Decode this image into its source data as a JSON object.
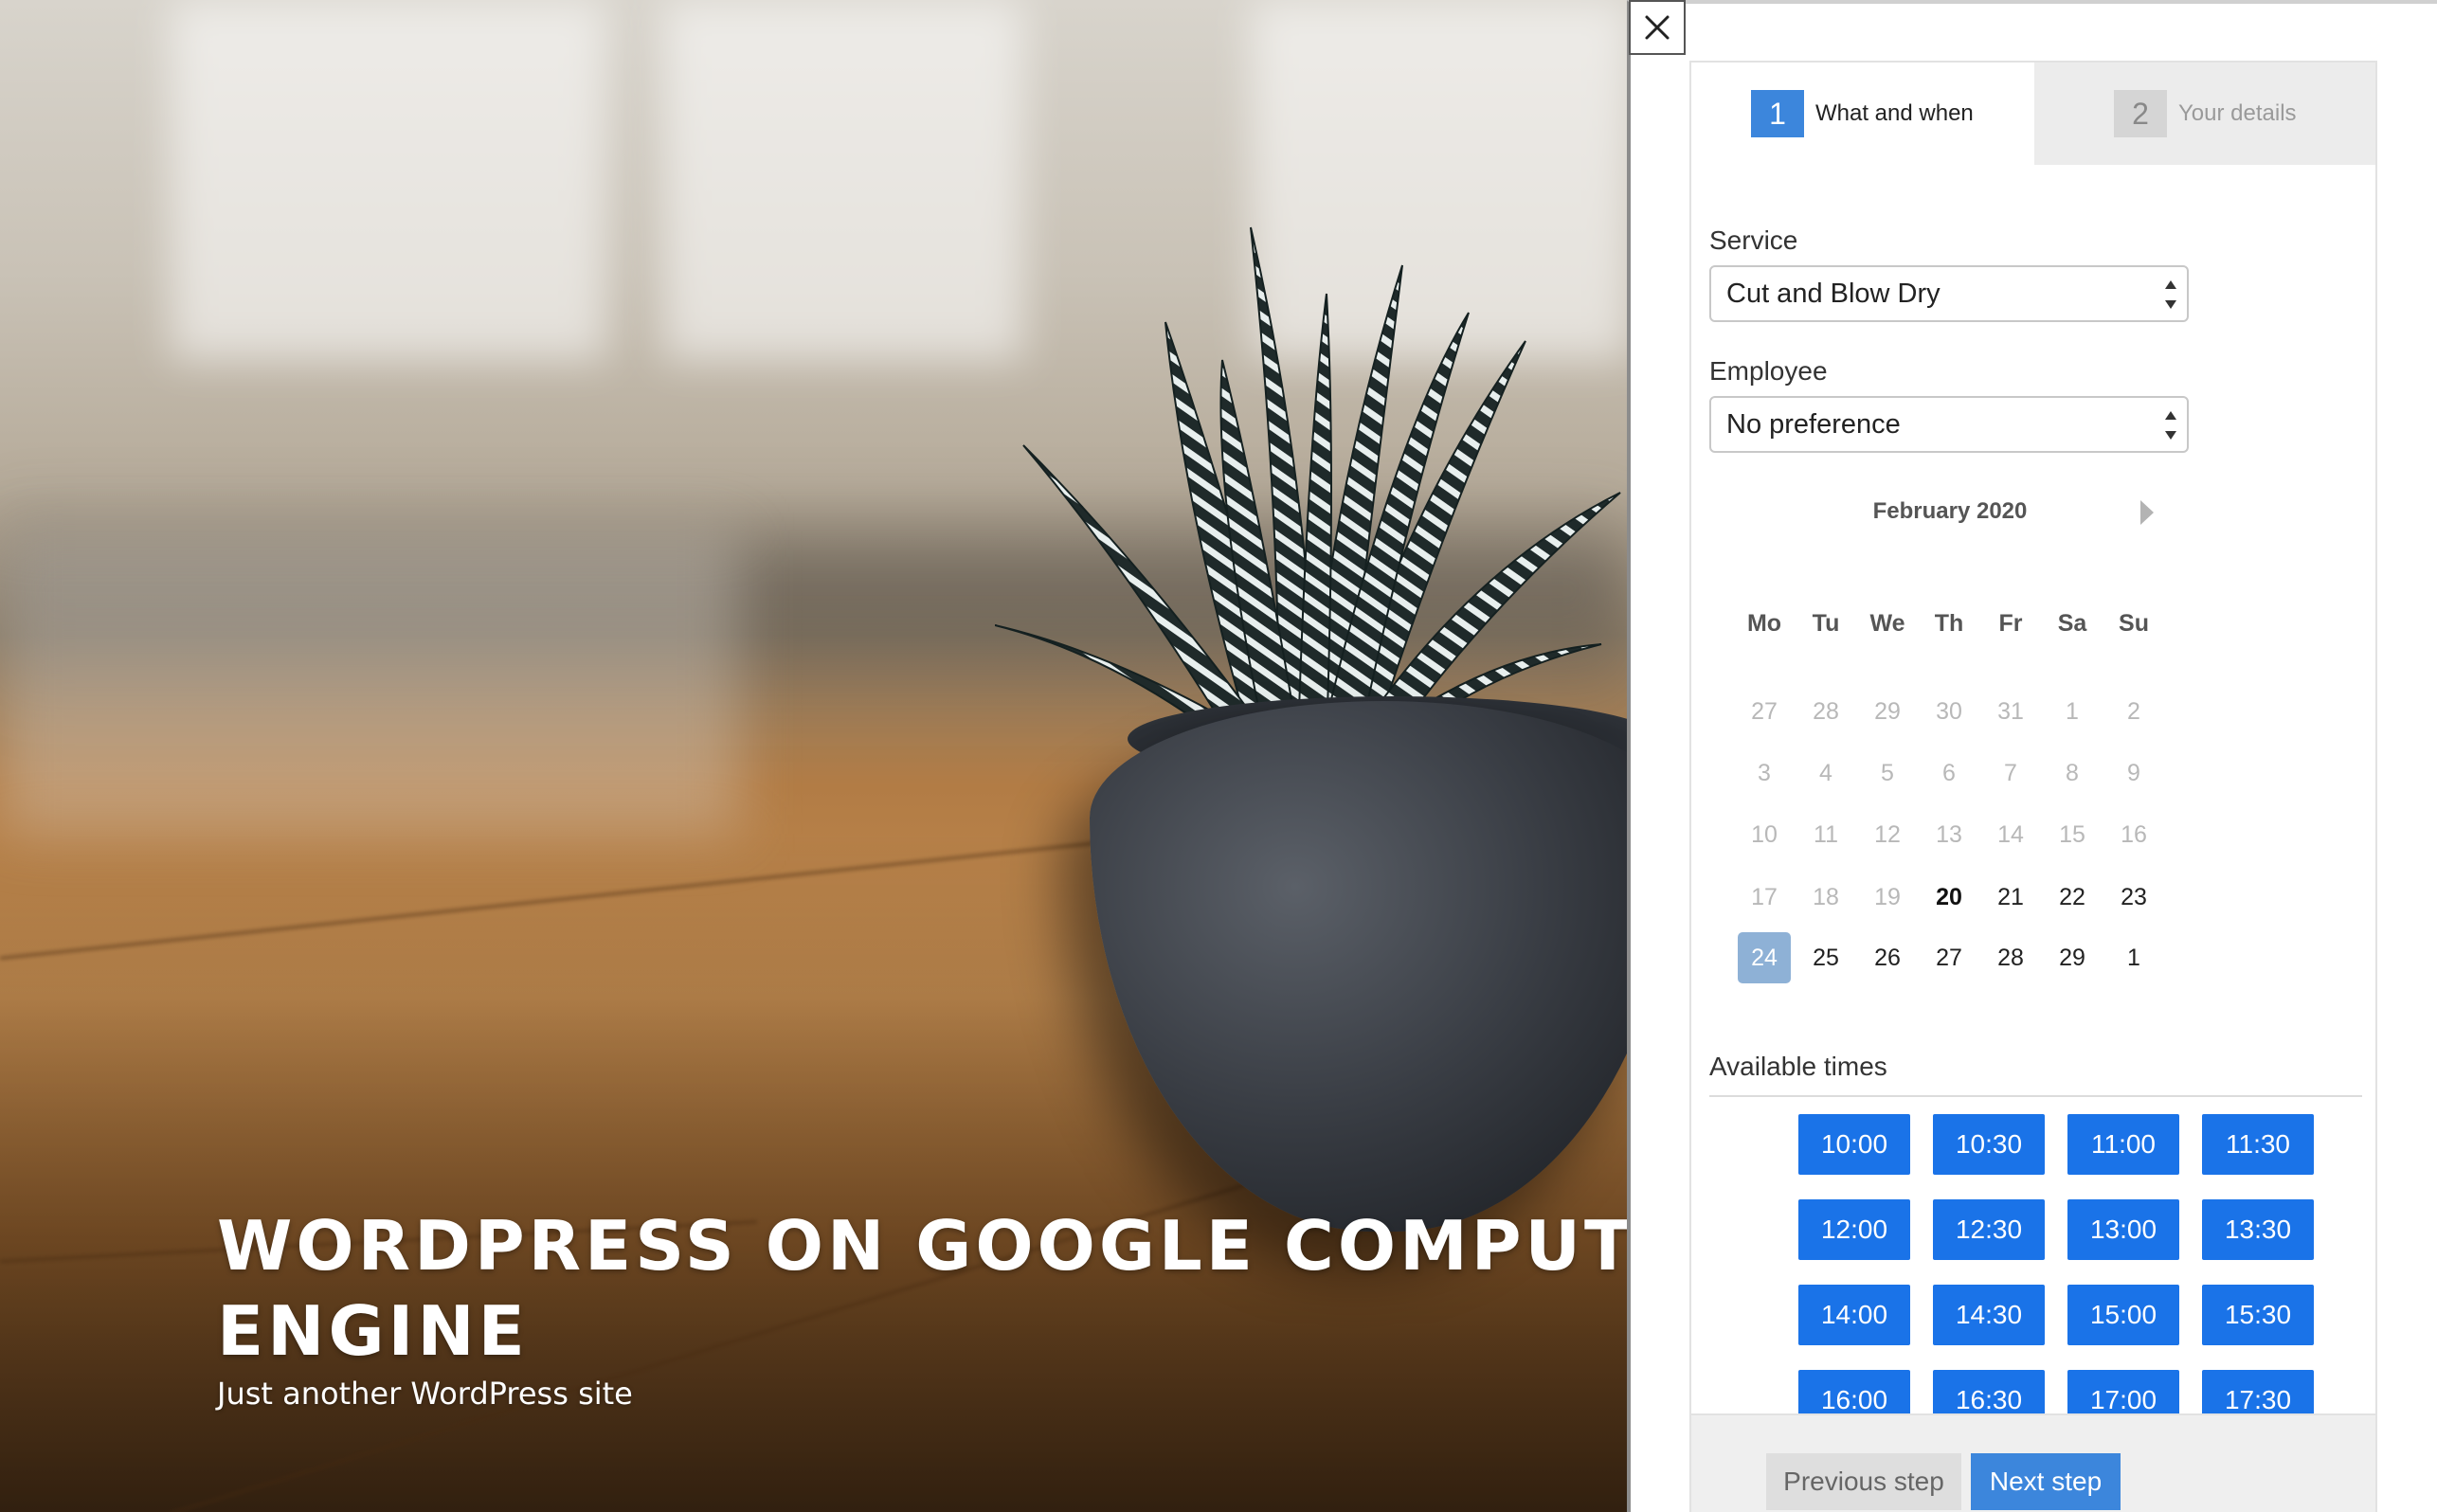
{
  "site": {
    "title": "WORDPRESS ON GOOGLE COMPUTE ENGINE",
    "tagline": "Just another WordPress site"
  },
  "panel": {
    "close_icon": "close-icon",
    "steps": [
      {
        "number": "1",
        "label": "What and when"
      },
      {
        "number": "2",
        "label": "Your details"
      }
    ],
    "service": {
      "label": "Service",
      "value": "Cut and Blow Dry"
    },
    "employee": {
      "label": "Employee",
      "value": "No preference"
    },
    "calendar": {
      "month": "February 2020",
      "weekdays": [
        "Mo",
        "Tu",
        "We",
        "Th",
        "Fr",
        "Sa",
        "Su"
      ],
      "weeks": [
        [
          {
            "d": "27",
            "s": "muted"
          },
          {
            "d": "28",
            "s": "muted"
          },
          {
            "d": "29",
            "s": "muted"
          },
          {
            "d": "30",
            "s": "muted"
          },
          {
            "d": "31",
            "s": "muted"
          },
          {
            "d": "1",
            "s": "muted"
          },
          {
            "d": "2",
            "s": "muted"
          }
        ],
        [
          {
            "d": "3",
            "s": "muted"
          },
          {
            "d": "4",
            "s": "muted"
          },
          {
            "d": "5",
            "s": "muted"
          },
          {
            "d": "6",
            "s": "muted"
          },
          {
            "d": "7",
            "s": "muted"
          },
          {
            "d": "8",
            "s": "muted"
          },
          {
            "d": "9",
            "s": "muted"
          }
        ],
        [
          {
            "d": "10",
            "s": "muted"
          },
          {
            "d": "11",
            "s": "muted"
          },
          {
            "d": "12",
            "s": "muted"
          },
          {
            "d": "13",
            "s": "muted"
          },
          {
            "d": "14",
            "s": "muted"
          },
          {
            "d": "15",
            "s": "muted"
          },
          {
            "d": "16",
            "s": "muted"
          }
        ],
        [
          {
            "d": "17",
            "s": "muted"
          },
          {
            "d": "18",
            "s": "muted"
          },
          {
            "d": "19",
            "s": "muted"
          },
          {
            "d": "20",
            "s": "today"
          },
          {
            "d": "21",
            "s": "available"
          },
          {
            "d": "22",
            "s": "available"
          },
          {
            "d": "23",
            "s": "available"
          }
        ],
        [
          {
            "d": "24",
            "s": "selected"
          },
          {
            "d": "25",
            "s": "available"
          },
          {
            "d": "26",
            "s": "available"
          },
          {
            "d": "27",
            "s": "available"
          },
          {
            "d": "28",
            "s": "available"
          },
          {
            "d": "29",
            "s": "available"
          },
          {
            "d": "1",
            "s": "available"
          }
        ]
      ]
    },
    "times_label": "Available times",
    "times": [
      "10:00",
      "10:30",
      "11:00",
      "11:30",
      "12:00",
      "12:30",
      "13:00",
      "13:30",
      "14:00",
      "14:30",
      "15:00",
      "15:30",
      "16:00",
      "16:30",
      "17:00",
      "17:30"
    ],
    "buttons": {
      "previous": "Previous step",
      "next": "Next step"
    }
  },
  "colors": {
    "accent": "#3c86dc",
    "time_button": "#1a73e8",
    "selected_day": "#8eb1d6"
  }
}
